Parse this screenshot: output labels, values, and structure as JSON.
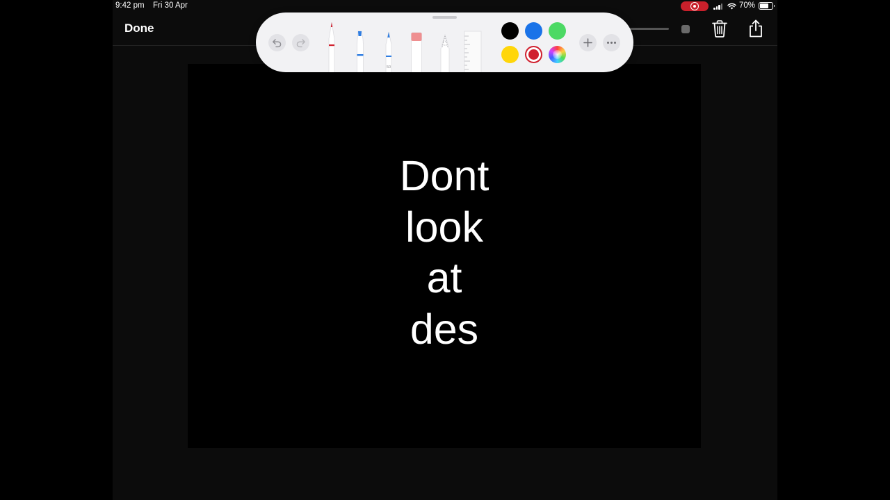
{
  "status_bar": {
    "time": "9:42 pm",
    "date": "Fri 30 Apr",
    "battery_percent": "70%",
    "battery_level": 0.7,
    "recording_indicator": true
  },
  "nav": {
    "done_label": "Done"
  },
  "toolbar": {
    "tools": [
      "pen-icon",
      "marker-icon",
      "pencil-icon",
      "eraser-icon",
      "lasso-icon",
      "ruler-icon"
    ],
    "pencil_label": "50",
    "colors": [
      "#000000",
      "#1a73e8",
      "#4cd964",
      "#ffd60a",
      "#d0202e",
      "multicolor"
    ],
    "selected_color": "#d0202e"
  },
  "note": {
    "lines": [
      "Dont",
      "look",
      "at",
      "des"
    ]
  }
}
